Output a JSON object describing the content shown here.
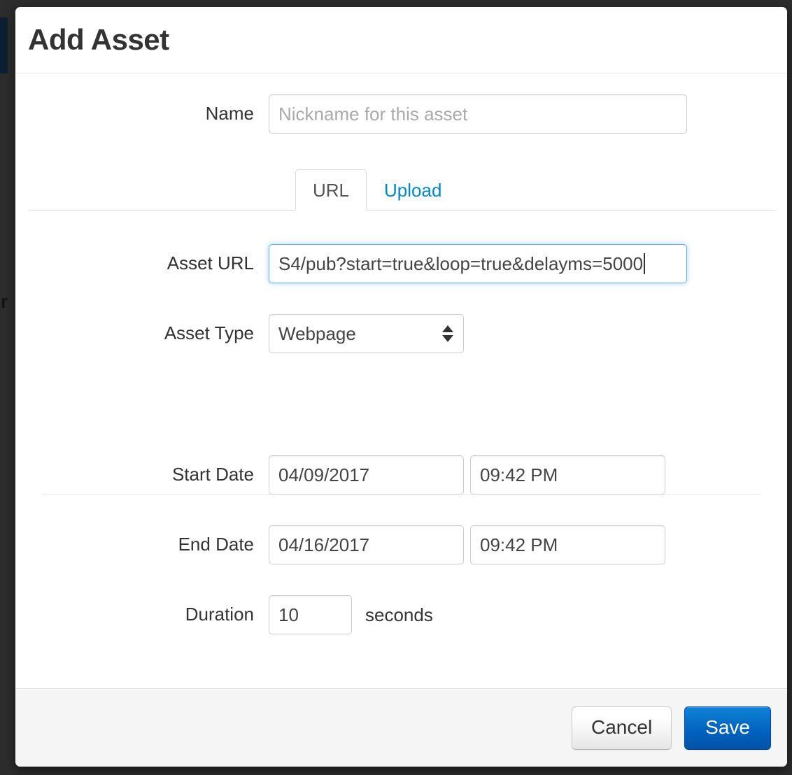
{
  "backdrop": {
    "partial_text": "er"
  },
  "modal": {
    "title": "Add Asset",
    "form": {
      "name": {
        "label": "Name",
        "value": "",
        "placeholder": "Nickname for this asset"
      },
      "tabs": [
        {
          "label": "URL",
          "active": true
        },
        {
          "label": "Upload",
          "active": false
        }
      ],
      "asset_url": {
        "label": "Asset URL",
        "value": "S4/pub?start=true&loop=true&delayms=5000",
        "focused": true
      },
      "asset_type": {
        "label": "Asset Type",
        "value": "Webpage",
        "icon": "select-updown-arrows-icon"
      },
      "start_date": {
        "label": "Start Date",
        "date": "04/09/2017",
        "time": "09:42 PM"
      },
      "end_date": {
        "label": "End Date",
        "date": "04/16/2017",
        "time": "09:42 PM"
      },
      "duration": {
        "label": "Duration",
        "value": "10",
        "unit": "seconds"
      }
    },
    "footer": {
      "cancel_label": "Cancel",
      "save_label": "Save"
    }
  },
  "colors": {
    "accent_link": "#0088cc",
    "primary_button": "#0061bd",
    "focus_ring": "#66afe9",
    "title_text": "#333333",
    "placeholder_text": "#aaaaaa"
  }
}
